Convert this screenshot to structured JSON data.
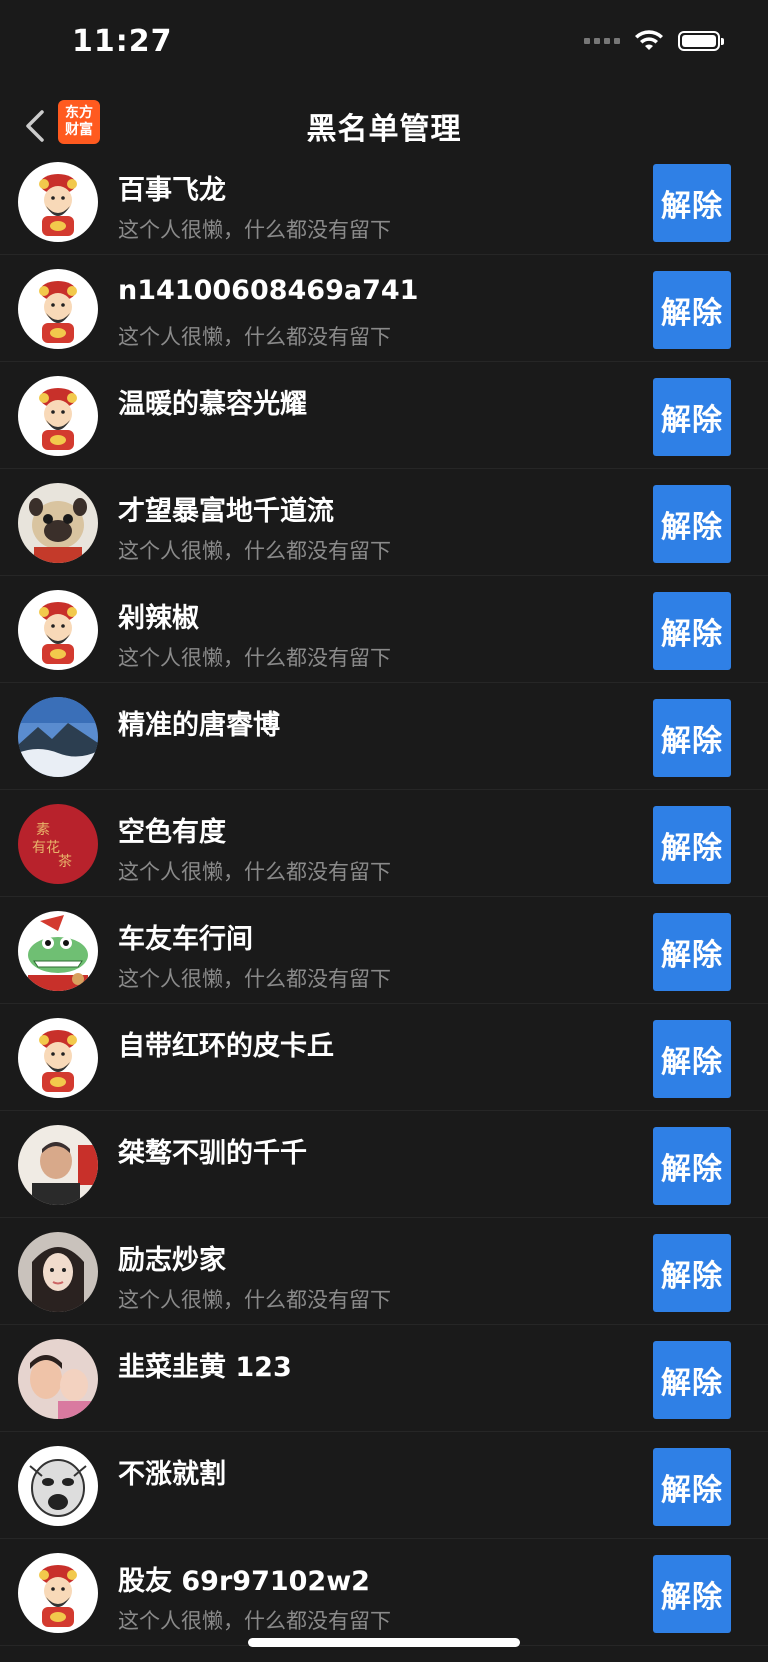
{
  "status": {
    "time": "11:27",
    "icons": [
      "cellular-signal-icon",
      "wifi-icon",
      "battery-icon"
    ]
  },
  "nav": {
    "back_icon": "chevron-left-icon",
    "logo_line1": "东方",
    "logo_line2": "财富",
    "title": "黑名单管理"
  },
  "colors": {
    "background": "#1a1a1a",
    "button": "#2f80e6",
    "logo": "#ff5a1f",
    "secondary_text": "#8a8a8a"
  },
  "list": {
    "unblock_label": "解除",
    "items": [
      {
        "name": "百事飞龙",
        "signature": "这个人很懒，什么都没有留下",
        "avatar": "mascot"
      },
      {
        "name": "n14100608469a741",
        "signature": "这个人很懒，什么都没有留下",
        "avatar": "mascot"
      },
      {
        "name": "温暖的慕容光耀",
        "signature": "",
        "avatar": "mascot"
      },
      {
        "name": "才望暴富地千道流",
        "signature": "这个人很懒，什么都没有留下",
        "avatar": "pug"
      },
      {
        "name": "剁辣椒",
        "signature": "这个人很懒，什么都没有留下",
        "avatar": "mascot"
      },
      {
        "name": "精准的唐睿博",
        "signature": "",
        "avatar": "landscape"
      },
      {
        "name": "空色有度",
        "signature": "这个人很懒，什么都没有留下",
        "avatar": "red-art"
      },
      {
        "name": "车友车行间",
        "signature": "这个人很懒，什么都没有留下",
        "avatar": "crocodile"
      },
      {
        "name": "自带红环的皮卡丘",
        "signature": "",
        "avatar": "mascot"
      },
      {
        "name": "桀骜不驯的千千",
        "signature": "",
        "avatar": "man-photo"
      },
      {
        "name": "励志炒家",
        "signature": "这个人很懒，什么都没有留下",
        "avatar": "woman-photo"
      },
      {
        "name": "韭菜韭黄 123",
        "signature": "",
        "avatar": "family-photo"
      },
      {
        "name": "不涨就割",
        "signature": "",
        "avatar": "meme"
      },
      {
        "name": "股友 69r97102w2",
        "signature": "这个人很懒，什么都没有留下",
        "avatar": "mascot"
      }
    ]
  }
}
